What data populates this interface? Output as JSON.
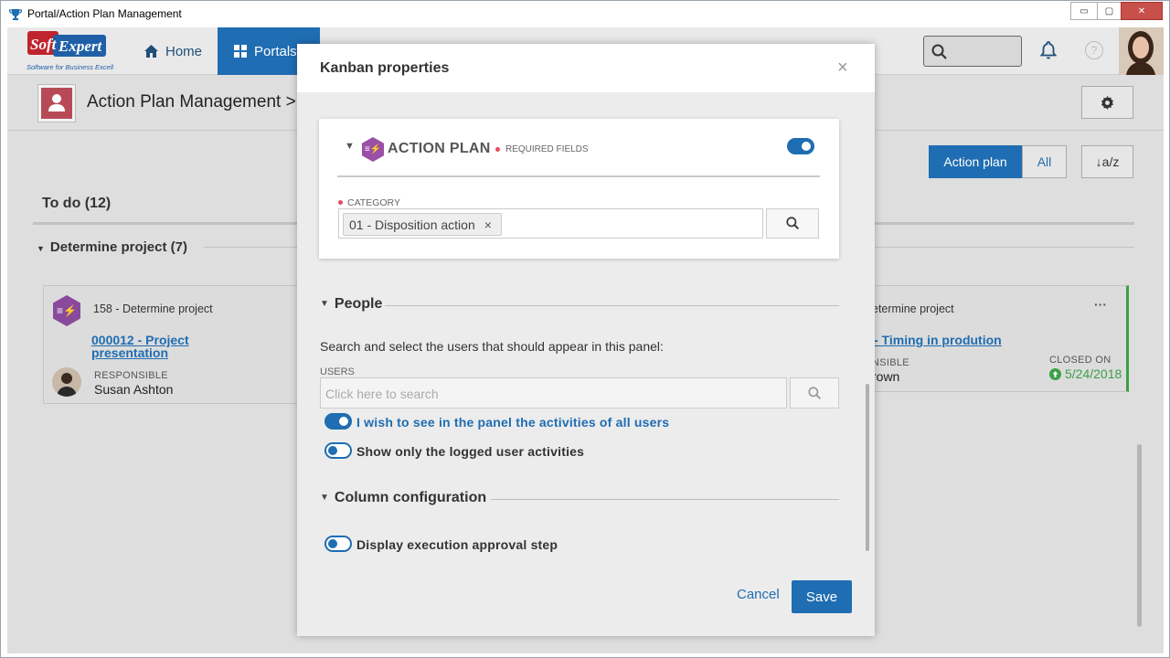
{
  "window": {
    "title": "Portal/Action Plan Management",
    "minimize": "▭",
    "maximize": "▢",
    "close": "✕"
  },
  "logo": {
    "brand_text": "SoftExpert",
    "tagline": "Software for Business Excellence"
  },
  "nav": {
    "home": "Home",
    "portals": "Portals",
    "help": "?"
  },
  "subheader": {
    "breadcrumb": "Action Plan Management > R"
  },
  "toolbar": {
    "action_plan": "Action plan",
    "all": "All",
    "sort": "↓a/z"
  },
  "board": {
    "column": "To do (12)",
    "group": "Determine project (7)",
    "cards": [
      {
        "category": "158 - Determine project",
        "link": "000012 - Project presentation",
        "resp_label": "RESPONSIBLE",
        "resp": "Susan Ashton"
      },
      {
        "category": "etermine project",
        "link": " - Timing in prodution",
        "resp_label": "NSIBLE",
        "resp": "rown",
        "closed_label": "CLOSED ON",
        "closed_date": "5/24/2018",
        "more": "···"
      }
    ]
  },
  "modal": {
    "title": "Kanban properties",
    "close": "×",
    "panel": {
      "title": "ACTION PLAN",
      "required": "REQUIRED FIELDS",
      "category_label": "CATEGORY",
      "category_chip": "01 - Disposition action",
      "chip_remove": "×"
    },
    "people": {
      "title": "People",
      "description": "Search and select the users that should appear in this panel:",
      "users_label": "USERS",
      "users_placeholder": "Click here to search",
      "toggle_all": "I wish to see in the panel the activities of all users",
      "toggle_logged": "Show only the logged user activities"
    },
    "columns": {
      "title": "Column configuration",
      "toggle_approval": "Display execution approval step"
    },
    "cancel": "Cancel",
    "save": "Save"
  },
  "colors": {
    "accent": "#1f6db2",
    "action_plan_icon": "#8a4a9c",
    "required_dot": "#e74c5c",
    "closed_green": "#3aa047"
  }
}
